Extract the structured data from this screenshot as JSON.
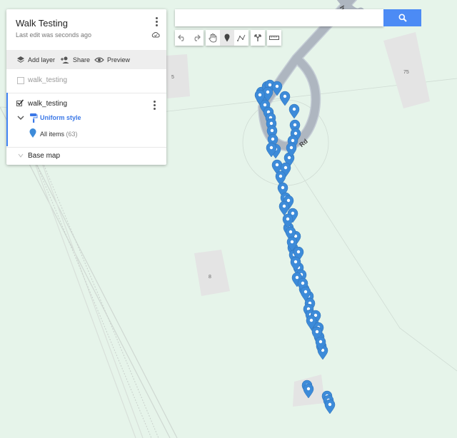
{
  "map": {
    "label_5": "5",
    "label_75": "75",
    "label_8": "8",
    "road_label": "Rd",
    "road_label_top": "ho",
    "pins_count": 63
  },
  "panel": {
    "title": "Walk Testing",
    "subtitle": "Last edit was seconds ago",
    "add_layer": "Add layer",
    "share": "Share",
    "preview": "Preview",
    "layer_inactive": "walk_testing",
    "layer_active": "walk_testing",
    "uniform_style": "Uniform style",
    "all_items": "All items",
    "all_items_count": "(63)",
    "base_map": "Base map"
  },
  "colors": {
    "map_bg": "#e6f4ea",
    "pin": "#3d8bd9",
    "accent": "#4285f4"
  },
  "icons": [
    "kebab-menu-icon",
    "cloud-sync-icon",
    "layers-icon",
    "person-add-icon",
    "eye-icon",
    "checkbox-icon",
    "chevron-down-icon",
    "paint-roller-icon",
    "place-pin-icon",
    "caret-icon",
    "search-icon",
    "undo-icon",
    "redo-icon",
    "hand-icon",
    "marker-icon",
    "polyline-icon",
    "directions-icon",
    "ruler-icon"
  ]
}
